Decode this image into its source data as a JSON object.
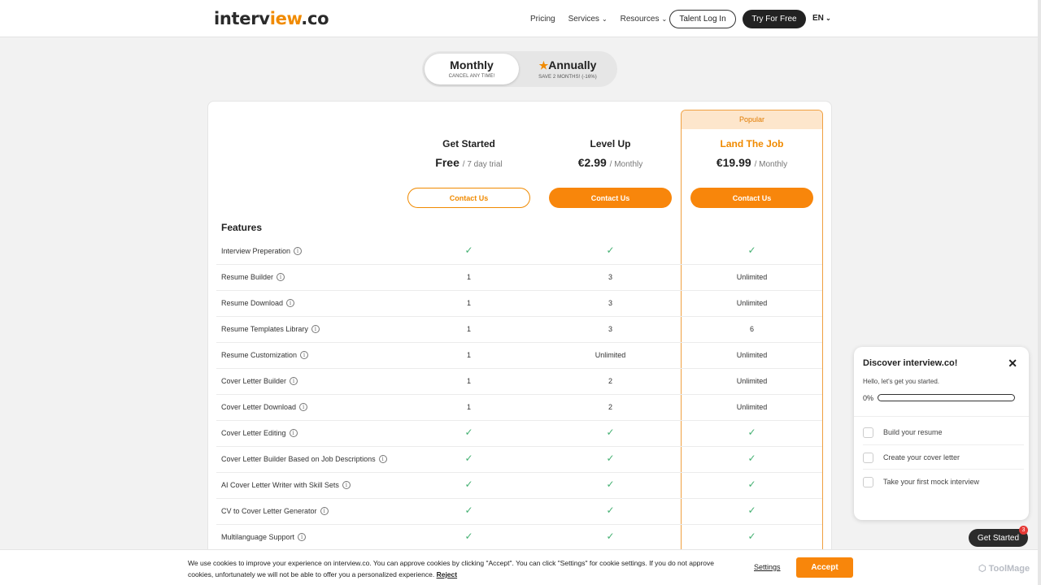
{
  "header": {
    "logo_main": "interv",
    "logo_accent": "iew",
    "logo_tld": ".co",
    "nav": [
      {
        "label": "Pricing",
        "has_menu": false
      },
      {
        "label": "Services",
        "has_menu": true
      },
      {
        "label": "Resources",
        "has_menu": true
      }
    ],
    "login_label": "Talent Log In",
    "try_label": "Try For Free",
    "lang_label": "EN"
  },
  "billing": {
    "monthly_label": "Monthly",
    "monthly_sub": "CANCEL ANY TIME!",
    "annual_label": "Annually",
    "annual_sub": "SAVE 2 MONTHS! (-16%)"
  },
  "plans": [
    {
      "name": "Get Started",
      "price": "Free",
      "period": "/ 7 day trial",
      "button": "Contact Us"
    },
    {
      "name": "Level Up",
      "price": "€2.99",
      "period": "/ Monthly",
      "button": "Contact Us"
    },
    {
      "name": "Land The Job",
      "price": "€19.99",
      "period": "/ Monthly",
      "button": "Contact Us",
      "badge": "Popular"
    }
  ],
  "features_title": "Features",
  "features": [
    {
      "name": "Interview Preperation",
      "values": [
        "check",
        "check",
        "check"
      ]
    },
    {
      "name": "Resume Builder",
      "values": [
        "1",
        "3",
        "Unlimited"
      ]
    },
    {
      "name": "Resume Download",
      "values": [
        "1",
        "3",
        "Unlimited"
      ]
    },
    {
      "name": "Resume Templates Library",
      "values": [
        "1",
        "3",
        "6"
      ]
    },
    {
      "name": "Resume Customization",
      "values": [
        "1",
        "Unlimited",
        "Unlimited"
      ]
    },
    {
      "name": "Cover Letter Builder",
      "values": [
        "1",
        "2",
        "Unlimited"
      ]
    },
    {
      "name": "Cover Letter Download",
      "values": [
        "1",
        "2",
        "Unlimited"
      ]
    },
    {
      "name": "Cover Letter Editing",
      "values": [
        "check",
        "check",
        "check"
      ]
    },
    {
      "name": "Cover Letter Builder Based on Job Descriptions",
      "values": [
        "check",
        "check",
        "check"
      ]
    },
    {
      "name": "AI Cover Letter Writer with Skill Sets",
      "values": [
        "check",
        "check",
        "check"
      ]
    },
    {
      "name": "CV to Cover Letter Generator",
      "values": [
        "check",
        "check",
        "check"
      ]
    },
    {
      "name": "Multilanguage Support",
      "values": [
        "check",
        "check",
        "check"
      ]
    }
  ],
  "widget": {
    "title": "Discover interview.co!",
    "subtitle": "Hello, let's get you started.",
    "progress_label": "0%",
    "progress": 0,
    "items": [
      "Build your resume",
      "Create your cover letter",
      "Take your first mock interview"
    ],
    "cta": "Get Started",
    "badge": "3"
  },
  "cookie": {
    "text": "We use cookies to improve your experience on interview.co. You can approve cookies by clicking \"Accept\". You can click \"Settings\" for cookie settings. If you do not approve cookies, unfortunately we will not be able to offer you a personalized experience.",
    "reject": "Reject",
    "settings": "Settings",
    "accept": "Accept"
  },
  "watermark": "ToolMage",
  "colors": {
    "accent": "#f8860b",
    "check": "#43b071",
    "dark": "#222222"
  }
}
